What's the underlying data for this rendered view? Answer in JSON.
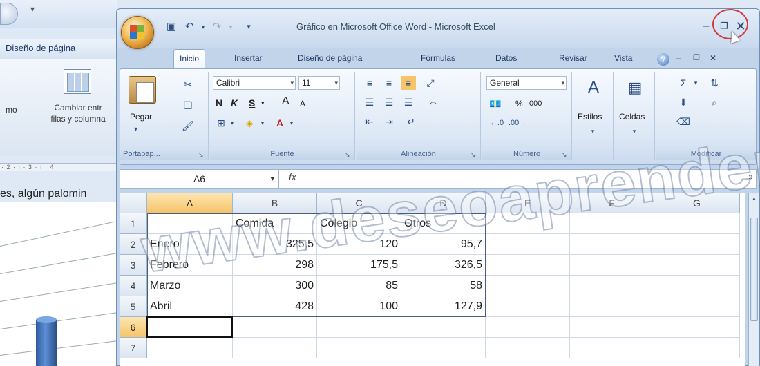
{
  "word": {
    "tab_label": "Diseño de página",
    "mo_label": "mo",
    "switch_label_line1": "Cambiar entr",
    "switch_label_line2": "filas y columna",
    "ruler_text": "· 2 · ı · 3 · ı · 4",
    "doc_text": "es, algún palomin"
  },
  "excel": {
    "title": "Gráfico en Microsoft Office Word - Microsoft Excel",
    "tabs": [
      "Inicio",
      "Insertar",
      "Diseño de página",
      "Fórmulas",
      "Datos",
      "Revisar",
      "Vista"
    ],
    "ribbon": {
      "clipboard": {
        "paste_label": "Pegar",
        "group_label": "Portapap..."
      },
      "font": {
        "name": "Calibri",
        "size": "11",
        "bold": "N",
        "italic": "K",
        "underline": "S",
        "grow": "A",
        "shrink": "A",
        "group_label": "Fuente"
      },
      "alignment": {
        "group_label": "Alineación"
      },
      "number": {
        "format": "General",
        "percent": "%",
        "thousands": "000",
        "group_label": "Número"
      },
      "styles": {
        "label": "Estilos"
      },
      "cells": {
        "label": "Celdas"
      },
      "editing": {
        "group_label": "Modificar"
      }
    },
    "name_box": "A6",
    "fx": "fx",
    "columns": [
      "A",
      "B",
      "C",
      "D",
      "E",
      "F",
      "G"
    ],
    "rows": [
      "1",
      "2",
      "3",
      "4",
      "5",
      "6",
      "7"
    ],
    "table": {
      "headers": [
        "",
        "Comida",
        "Colegio",
        "Otros"
      ],
      "data": [
        [
          "Enero",
          "325,5",
          "120",
          "95,7"
        ],
        [
          "Febrero",
          "298",
          "175,5",
          "326,5"
        ],
        [
          "Marzo",
          "300",
          "85",
          "58"
        ],
        [
          "Abril",
          "428",
          "100",
          "127,9"
        ]
      ]
    },
    "active_cell": "A6"
  },
  "watermark": "www.deseoaprender.com",
  "colors": {
    "close_circle": "#d23a3a",
    "selected_header": "#f6c46b",
    "ribbon_bg": "#dde8f5"
  }
}
